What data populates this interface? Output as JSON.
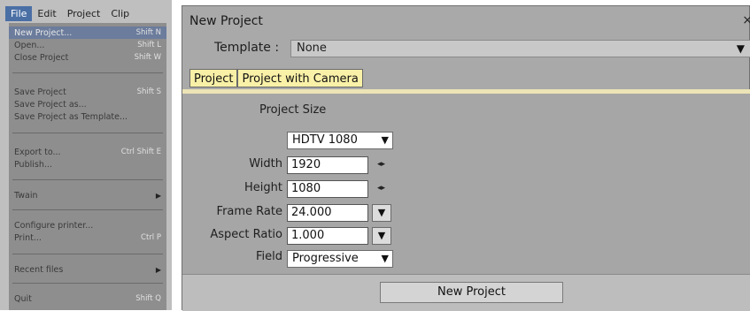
{
  "menubar": {
    "items": [
      "File",
      "Edit",
      "Project",
      "Clip"
    ]
  },
  "file_menu": {
    "items": [
      {
        "label": "New Project...",
        "shortcut": "Shift N"
      },
      {
        "label": "Open...",
        "shortcut": "Shift L"
      },
      {
        "label": "Close Project",
        "shortcut": "Shift W"
      },
      {
        "label": "Save Project",
        "shortcut": "Shift S"
      },
      {
        "label": "Save Project as...",
        "shortcut": ""
      },
      {
        "label": "Save Project as Template...",
        "shortcut": ""
      },
      {
        "label": "Export to...",
        "shortcut": "Ctrl Shift E"
      },
      {
        "label": "Publish...",
        "shortcut": ""
      },
      {
        "label": "Twain",
        "shortcut": ""
      },
      {
        "label": "Configure printer...",
        "shortcut": ""
      },
      {
        "label": "Print...",
        "shortcut": "Ctrl P"
      },
      {
        "label": "Recent files",
        "shortcut": ""
      },
      {
        "label": "Quit",
        "shortcut": "Shift Q"
      }
    ],
    "submenu_arrow": "▶"
  },
  "dialog": {
    "title": "New Project",
    "close_glyph": "×",
    "template_label": "Template :",
    "template_value": "None",
    "dropdown_glyph": "▼",
    "tabs": [
      "Project",
      "Project with Camera"
    ],
    "section_title": "Project Size",
    "size_preset": "HDTV 1080",
    "width_label": "Width",
    "width_value": "1920",
    "height_label": "Height",
    "height_value": "1080",
    "spin_glyph": "◂▸",
    "frame_rate_label": "Frame Rate",
    "frame_rate_value": "24.000",
    "aspect_ratio_label": "Aspect Ratio",
    "aspect_ratio_value": "1.000",
    "field_label": "Field",
    "field_value": "Progressive",
    "new_project_button": "New Project"
  }
}
